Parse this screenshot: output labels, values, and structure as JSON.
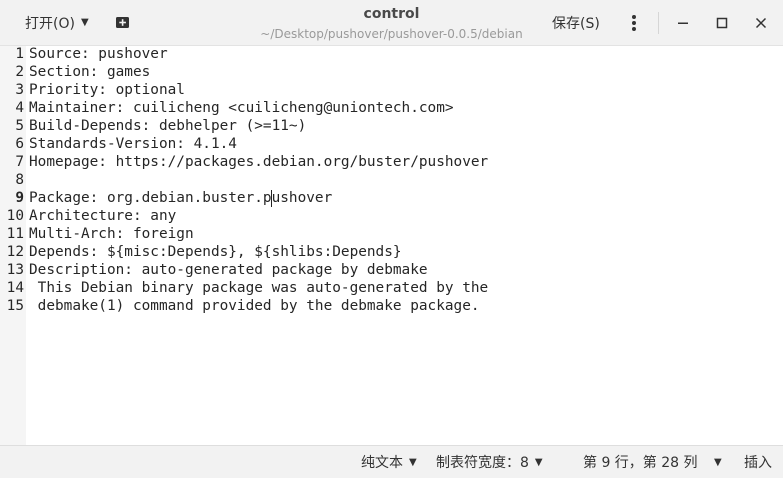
{
  "header": {
    "open_label": "打开(O)",
    "title": "control",
    "subtitle": "~/Desktop/pushover/pushover-0.0.5/debian",
    "save_label": "保存(S)"
  },
  "editor": {
    "current_line": 9,
    "lines": [
      {
        "n": "1",
        "text": "Source: pushover"
      },
      {
        "n": "2",
        "text": "Section: games"
      },
      {
        "n": "3",
        "text": "Priority: optional"
      },
      {
        "n": "4",
        "text": "Maintainer: cuilicheng <cuilicheng@uniontech.com>"
      },
      {
        "n": "5",
        "text": "Build-Depends: debhelper (>=11~)"
      },
      {
        "n": "6",
        "text": "Standards-Version: 4.1.4"
      },
      {
        "n": "7",
        "text": "Homepage: https://packages.debian.org/buster/pushover"
      },
      {
        "n": "8",
        "text": ""
      },
      {
        "n": "9",
        "text": "Package: org.debian.buster.pushover"
      },
      {
        "n": "10",
        "text": "Architecture: any"
      },
      {
        "n": "11",
        "text": "Multi-Arch: foreign"
      },
      {
        "n": "12",
        "text": "Depends: ${misc:Depends}, ${shlibs:Depends}"
      },
      {
        "n": "13",
        "text": "Description: auto-generated package by debmake"
      },
      {
        "n": "14",
        "text": " This Debian binary package was auto-generated by the"
      },
      {
        "n": "15",
        "text": " debmake(1) command provided by the debmake package."
      }
    ]
  },
  "status": {
    "language": "纯文本",
    "tab_width": "制表符宽度：8",
    "position": "第 9 行，第 28 列",
    "insert_mode": "插入"
  }
}
